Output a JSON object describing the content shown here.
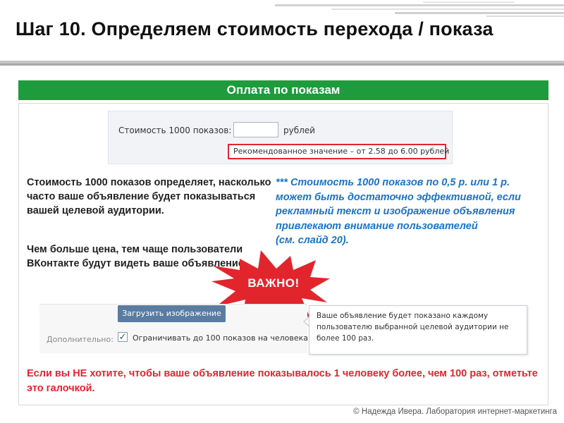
{
  "slide": {
    "title": "Шаг 10. Определяем стоимость перехода / показа",
    "footer": "© Надежда Ивера. Лаборатория интернет-маркетинга"
  },
  "panel": {
    "header": "Оплата по показам"
  },
  "cost_form": {
    "label": "Стоимость 1000 показов:",
    "input_value": "",
    "unit": "рублей",
    "recommendation": "Рекомендованное значение – от 2.58 до 6.00 рублей"
  },
  "description": {
    "paragraph1": "Стоимость 1000 показов определяет, насколько часто ваше объявление будет показываться вашей целевой аудитории.",
    "paragraph2": "Чем больше цена, тем чаще пользователи ВКонтакте будут видеть ваше объявление"
  },
  "note": {
    "text": "*** Стоимость 1000 показов по 0,5 р. или 1 р. может быть достаточно эффективной, если рекламный текст и изображение объявления привлекают внимание пользователей",
    "ref": "(см. слайд 20)."
  },
  "badge": {
    "label": "ВАЖНО!",
    "color": "#e2252d"
  },
  "upload_form": {
    "upload_button": "Загрузить изображение",
    "extra_label": "Дополнительно:",
    "limit_checkbox_label": "Ограничивать до 100 показов на человека",
    "limit_checked": true,
    "tooltip": "Ваше объявление будет показано каждому пользователю выбранной целевой аудитории не более 100 раз."
  },
  "warning": {
    "text": "Если вы НЕ хотите, чтобы ваше объявление показывалось 1 человеку более, чем 100 раз, отметьте это галочкой."
  },
  "colors": {
    "header_green": "#1e9c3d",
    "accent_red": "#e2252d",
    "note_blue": "#1a73c8",
    "vk_button": "#5a7ca0"
  }
}
